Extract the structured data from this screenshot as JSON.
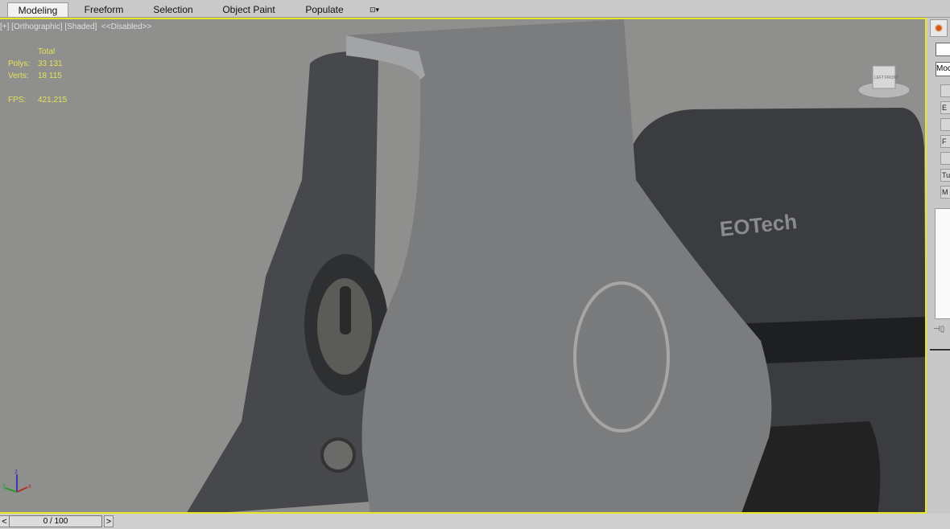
{
  "ribbon": {
    "tabs": [
      "Modeling",
      "Freeform",
      "Selection",
      "Object Paint",
      "Populate"
    ],
    "active": "Modeling"
  },
  "viewport": {
    "label": "[+] [Orthographic] [Shaded]  <<Disabled>>",
    "stats": {
      "header": "Total",
      "polys_label": "Polys:",
      "polys": "33 131",
      "verts_label": "Verts:",
      "verts": "18 115",
      "fps_label": "FPS:",
      "fps": "421,215"
    },
    "viewcube": {
      "left": "LEFT",
      "front": "FRONT"
    },
    "model_logo": "EOTech",
    "axes": {
      "x": "x",
      "y": "y",
      "z": "z"
    }
  },
  "command_panel": {
    "modifier_list": "Moc",
    "buttons": [
      "",
      "E",
      "",
      "F",
      "",
      "Tu",
      "M"
    ]
  },
  "timeline": {
    "frame": "0 / 100",
    "prev": "<",
    "next": ">"
  },
  "colors": {
    "viewport_border": "#e6e62a",
    "stats_text": "#e3e35a"
  }
}
